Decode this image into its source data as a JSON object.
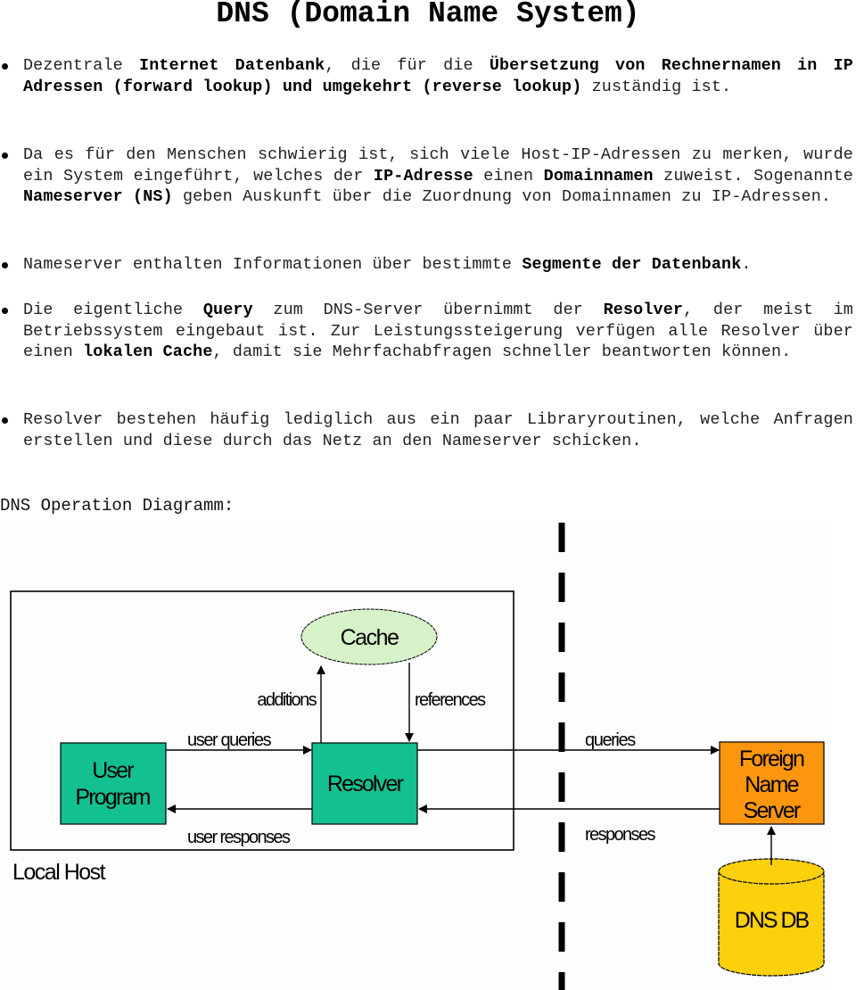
{
  "document": {
    "title": "DNS (Domain Name System)",
    "bullets": [
      {
        "segments": [
          {
            "text": "Dezentrale ",
            "bold": false
          },
          {
            "text": "Internet Datenbank",
            "bold": true
          },
          {
            "text": ", die für die ",
            "bold": false
          },
          {
            "text": "Übersetzung von Rechnernamen in IP Adressen (forward lookup) und umgekehrt (reverse lookup)",
            "bold": true
          },
          {
            "text": " zuständig ist.",
            "bold": false
          }
        ]
      },
      {
        "segments": [
          {
            "text": "Da es für den Menschen schwierig ist, sich viele Host-IP-Adressen zu merken, wurde ein System eingeführt, welches der ",
            "bold": false
          },
          {
            "text": "IP-Adresse",
            "bold": true
          },
          {
            "text": " einen ",
            "bold": false
          },
          {
            "text": "Domainnamen",
            "bold": true
          },
          {
            "text": " zuweist. Sogenannte ",
            "bold": false
          },
          {
            "text": "Nameserver (NS)",
            "bold": true
          },
          {
            "text": " geben Auskunft über die Zuordnung von Domainnamen zu IP-Adressen.",
            "bold": false
          }
        ]
      },
      {
        "segments": [
          {
            "text": "Nameserver enthalten Informationen über bestimmte ",
            "bold": false
          },
          {
            "text": "Segmente der Datenbank",
            "bold": true
          },
          {
            "text": ".",
            "bold": false
          }
        ]
      },
      {
        "segments": [
          {
            "text": "Die eigentliche ",
            "bold": false
          },
          {
            "text": "Query",
            "bold": true
          },
          {
            "text": " zum DNS-Server übernimmt der ",
            "bold": false
          },
          {
            "text": "Resolver",
            "bold": true
          },
          {
            "text": ", der meist im Betriebssystem eingebaut ist. Zur Leistungssteigerung verfügen alle Resolver über einen ",
            "bold": false
          },
          {
            "text": "lokalen Cache",
            "bold": true
          },
          {
            "text": ", damit sie Mehrfachabfragen schneller beantworten können.",
            "bold": false
          }
        ]
      },
      {
        "segments": [
          {
            "text": "Resolver bestehen häufig lediglich aus ein paar Libraryroutinen, welche Anfragen erstellen und diese durch das Netz an den Nameserver schicken.",
            "bold": false
          }
        ]
      }
    ],
    "diagram_heading": "DNS Operation Diagramm:"
  },
  "diagram": {
    "nodes": {
      "cache": {
        "label": "Cache",
        "color": "#d6f2c8"
      },
      "user_program": {
        "label_lines": [
          "User",
          "Program"
        ],
        "color": "#13c08f"
      },
      "resolver": {
        "label": "Resolver",
        "color": "#13c08f"
      },
      "foreign_name_server": {
        "label_lines": [
          "Foreign",
          "Name",
          "Server"
        ],
        "color": "#fb960d"
      },
      "dns_db": {
        "label": "DNS DB",
        "color": "#fcd00c"
      }
    },
    "edges": {
      "additions": "additions",
      "references": "references",
      "user_queries": "user queries",
      "user_responses": "user responses",
      "queries": "queries",
      "responses": "responses"
    },
    "local_host_label": "Local Host"
  }
}
